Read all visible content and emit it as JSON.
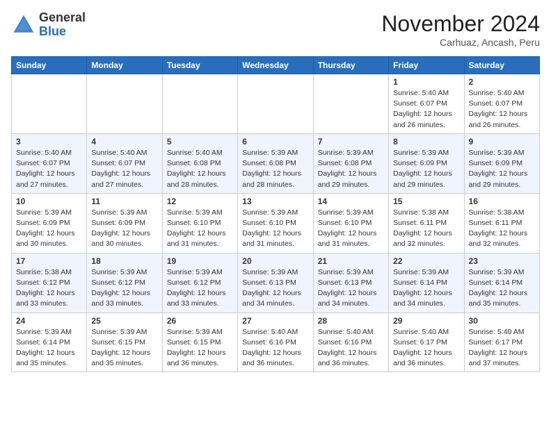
{
  "header": {
    "logo_general": "General",
    "logo_blue": "Blue",
    "month_year": "November 2024",
    "location": "Carhuaz, Ancash, Peru"
  },
  "days_of_week": [
    "Sunday",
    "Monday",
    "Tuesday",
    "Wednesday",
    "Thursday",
    "Friday",
    "Saturday"
  ],
  "weeks": [
    [
      {
        "day": "",
        "info": ""
      },
      {
        "day": "",
        "info": ""
      },
      {
        "day": "",
        "info": ""
      },
      {
        "day": "",
        "info": ""
      },
      {
        "day": "",
        "info": ""
      },
      {
        "day": "1",
        "info": "Sunrise: 5:40 AM\nSunset: 6:07 PM\nDaylight: 12 hours and 26 minutes."
      },
      {
        "day": "2",
        "info": "Sunrise: 5:40 AM\nSunset: 6:07 PM\nDaylight: 12 hours and 26 minutes."
      }
    ],
    [
      {
        "day": "3",
        "info": "Sunrise: 5:40 AM\nSunset: 6:07 PM\nDaylight: 12 hours and 27 minutes."
      },
      {
        "day": "4",
        "info": "Sunrise: 5:40 AM\nSunset: 6:07 PM\nDaylight: 12 hours and 27 minutes."
      },
      {
        "day": "5",
        "info": "Sunrise: 5:40 AM\nSunset: 6:08 PM\nDaylight: 12 hours and 28 minutes."
      },
      {
        "day": "6",
        "info": "Sunrise: 5:39 AM\nSunset: 6:08 PM\nDaylight: 12 hours and 28 minutes."
      },
      {
        "day": "7",
        "info": "Sunrise: 5:39 AM\nSunset: 6:08 PM\nDaylight: 12 hours and 29 minutes."
      },
      {
        "day": "8",
        "info": "Sunrise: 5:39 AM\nSunset: 6:09 PM\nDaylight: 12 hours and 29 minutes."
      },
      {
        "day": "9",
        "info": "Sunrise: 5:39 AM\nSunset: 6:09 PM\nDaylight: 12 hours and 29 minutes."
      }
    ],
    [
      {
        "day": "10",
        "info": "Sunrise: 5:39 AM\nSunset: 6:09 PM\nDaylight: 12 hours and 30 minutes."
      },
      {
        "day": "11",
        "info": "Sunrise: 5:39 AM\nSunset: 6:09 PM\nDaylight: 12 hours and 30 minutes."
      },
      {
        "day": "12",
        "info": "Sunrise: 5:39 AM\nSunset: 6:10 PM\nDaylight: 12 hours and 31 minutes."
      },
      {
        "day": "13",
        "info": "Sunrise: 5:39 AM\nSunset: 6:10 PM\nDaylight: 12 hours and 31 minutes."
      },
      {
        "day": "14",
        "info": "Sunrise: 5:39 AM\nSunset: 6:10 PM\nDaylight: 12 hours and 31 minutes."
      },
      {
        "day": "15",
        "info": "Sunrise: 5:38 AM\nSunset: 6:11 PM\nDaylight: 12 hours and 32 minutes."
      },
      {
        "day": "16",
        "info": "Sunrise: 5:38 AM\nSunset: 6:11 PM\nDaylight: 12 hours and 32 minutes."
      }
    ],
    [
      {
        "day": "17",
        "info": "Sunrise: 5:38 AM\nSunset: 6:12 PM\nDaylight: 12 hours and 33 minutes."
      },
      {
        "day": "18",
        "info": "Sunrise: 5:39 AM\nSunset: 6:12 PM\nDaylight: 12 hours and 33 minutes."
      },
      {
        "day": "19",
        "info": "Sunrise: 5:39 AM\nSunset: 6:12 PM\nDaylight: 12 hours and 33 minutes."
      },
      {
        "day": "20",
        "info": "Sunrise: 5:39 AM\nSunset: 6:13 PM\nDaylight: 12 hours and 34 minutes."
      },
      {
        "day": "21",
        "info": "Sunrise: 5:39 AM\nSunset: 6:13 PM\nDaylight: 12 hours and 34 minutes."
      },
      {
        "day": "22",
        "info": "Sunrise: 5:39 AM\nSunset: 6:14 PM\nDaylight: 12 hours and 34 minutes."
      },
      {
        "day": "23",
        "info": "Sunrise: 5:39 AM\nSunset: 6:14 PM\nDaylight: 12 hours and 35 minutes."
      }
    ],
    [
      {
        "day": "24",
        "info": "Sunrise: 5:39 AM\nSunset: 6:14 PM\nDaylight: 12 hours and 35 minutes."
      },
      {
        "day": "25",
        "info": "Sunrise: 5:39 AM\nSunset: 6:15 PM\nDaylight: 12 hours and 35 minutes."
      },
      {
        "day": "26",
        "info": "Sunrise: 5:39 AM\nSunset: 6:15 PM\nDaylight: 12 hours and 36 minutes."
      },
      {
        "day": "27",
        "info": "Sunrise: 5:40 AM\nSunset: 6:16 PM\nDaylight: 12 hours and 36 minutes."
      },
      {
        "day": "28",
        "info": "Sunrise: 5:40 AM\nSunset: 6:16 PM\nDaylight: 12 hours and 36 minutes."
      },
      {
        "day": "29",
        "info": "Sunrise: 5:40 AM\nSunset: 6:17 PM\nDaylight: 12 hours and 36 minutes."
      },
      {
        "day": "30",
        "info": "Sunrise: 5:40 AM\nSunset: 6:17 PM\nDaylight: 12 hours and 37 minutes."
      }
    ]
  ]
}
